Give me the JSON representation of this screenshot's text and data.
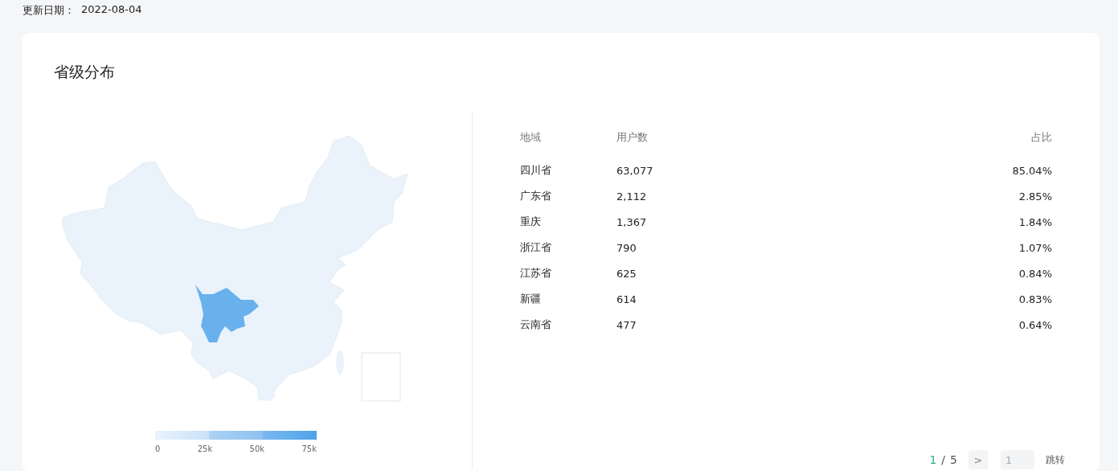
{
  "update": {
    "label": "更新日期：",
    "value": "2022-08-04"
  },
  "card": {
    "title": "省级分布"
  },
  "legend": {
    "ticks": [
      "0",
      "25k",
      "50k",
      "75k"
    ]
  },
  "table": {
    "columns": [
      "地域",
      "用户数",
      "占比"
    ],
    "rows": [
      {
        "region": "四川省",
        "users": "63,077",
        "share": "85.04%"
      },
      {
        "region": "广东省",
        "users": "2,112",
        "share": "2.85%"
      },
      {
        "region": "重庆",
        "users": "1,367",
        "share": "1.84%"
      },
      {
        "region": "浙江省",
        "users": "790",
        "share": "1.07%"
      },
      {
        "region": "江苏省",
        "users": "625",
        "share": "0.84%"
      },
      {
        "region": "新疆",
        "users": "614",
        "share": "0.83%"
      },
      {
        "region": "云南省",
        "users": "477",
        "share": "0.64%"
      }
    ]
  },
  "pagination": {
    "current": "1",
    "separator": "/",
    "total": "5",
    "next": ">",
    "jump_placeholder": "1",
    "jump_button": "跳转"
  }
}
